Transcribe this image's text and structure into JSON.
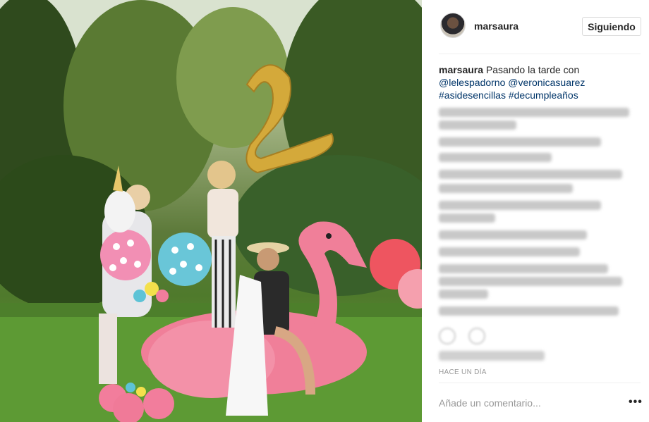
{
  "post": {
    "username": "marsaura",
    "follow_label": "Siguiendo",
    "caption": {
      "user": "marsaura",
      "text": "Pasando la tarde con",
      "mentions": [
        "@lelespadorno",
        "@veronicasuarez"
      ],
      "hashtags": [
        "#asidesencillas",
        "#decumpleaños"
      ]
    },
    "timestamp": "HACE UN DÍA",
    "comment_placeholder": "Añade un comentario...",
    "more_label": "•••"
  },
  "colors": {
    "accent_link": "#003569",
    "muted": "#999999",
    "border": "#dbdbdb",
    "flamingo": "#f07f99",
    "balloon_gold": "#d4a93a"
  },
  "icons": [
    "avatar",
    "heart-icon",
    "comment-icon",
    "more-icon"
  ]
}
